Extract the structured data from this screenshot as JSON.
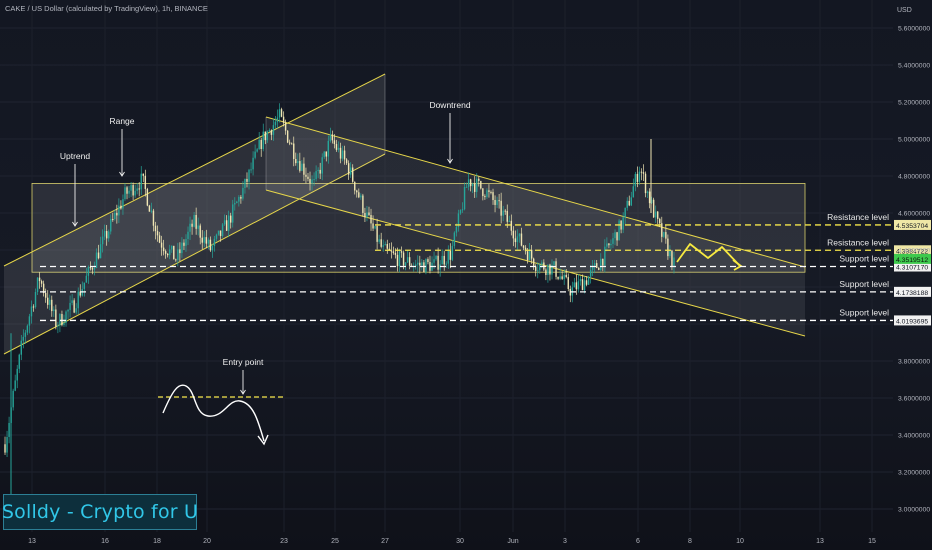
{
  "header": {
    "title": "CAKE / US Dollar (calculated by TradingView), 1h, BINANCE"
  },
  "brand": {
    "text": "Solldy - Crypto for U"
  },
  "colors": {
    "background": "#131722",
    "up": "#26a69a",
    "down": "#f0e6b4",
    "channel_line": "#e6d64a",
    "resistance": "#f5e64a",
    "support": "#ffffff",
    "annotation": "#ffffff",
    "last_price_bg": "#3ec94d",
    "projection": "#f7ea40"
  },
  "chart_data": {
    "type": "candlestick",
    "symbol": "CAKE / USD",
    "interval": "1h",
    "exchange": "BINANCE",
    "y_axis": {
      "unit": "USD",
      "ticks": [
        "5.6000000",
        "5.4000000",
        "5.2000000",
        "5.0000000",
        "4.8000000",
        "4.6000000",
        "4.4000000",
        "3.8000000",
        "3.6000000",
        "3.4000000",
        "3.2000000",
        "3.0000000"
      ],
      "range": [
        2.95,
        5.75
      ]
    },
    "x_axis": {
      "ticks": [
        "13",
        "16",
        "18",
        "20",
        "23",
        "25",
        "27",
        "30",
        "Jun",
        "3",
        "6",
        "8",
        "10",
        "13",
        "15"
      ]
    },
    "price_series": [
      {
        "t": "13",
        "price": 3.35
      },
      {
        "t": "13",
        "price": 3.9
      },
      {
        "t": "13",
        "price": 4.25
      },
      {
        "t": "14",
        "price": 4.0
      },
      {
        "t": "15",
        "price": 4.1
      },
      {
        "t": "15",
        "price": 4.3
      },
      {
        "t": "16",
        "price": 4.5
      },
      {
        "t": "17",
        "price": 4.7
      },
      {
        "t": "17",
        "price": 4.78
      },
      {
        "t": "18",
        "price": 4.45
      },
      {
        "t": "18",
        "price": 4.35
      },
      {
        "t": "19",
        "price": 4.55
      },
      {
        "t": "20",
        "price": 4.4
      },
      {
        "t": "21",
        "price": 4.55
      },
      {
        "t": "22",
        "price": 4.75
      },
      {
        "t": "23",
        "price": 5.0
      },
      {
        "t": "23",
        "price": 5.12
      },
      {
        "t": "24",
        "price": 4.9
      },
      {
        "t": "24",
        "price": 4.75
      },
      {
        "t": "25",
        "price": 5.0
      },
      {
        "t": "25",
        "price": 4.85
      },
      {
        "t": "26",
        "price": 4.6
      },
      {
        "t": "26",
        "price": 4.4
      },
      {
        "t": "27",
        "price": 4.35
      },
      {
        "t": "28",
        "price": 4.32
      },
      {
        "t": "29",
        "price": 4.32
      },
      {
        "t": "29",
        "price": 4.38
      },
      {
        "t": "30",
        "price": 4.78
      },
      {
        "t": "30",
        "price": 4.72
      },
      {
        "t": "31",
        "price": 4.6
      },
      {
        "t": "Jun",
        "price": 4.45
      },
      {
        "t": "Jun",
        "price": 4.32
      },
      {
        "t": "2",
        "price": 4.3
      },
      {
        "t": "3",
        "price": 4.18
      },
      {
        "t": "4",
        "price": 4.25
      },
      {
        "t": "5",
        "price": 4.38
      },
      {
        "t": "6",
        "price": 4.55
      },
      {
        "t": "6",
        "price": 4.85
      },
      {
        "t": "6",
        "price": 4.55
      },
      {
        "t": "7",
        "price": 4.32
      }
    ],
    "horizontal_levels": [
      {
        "label": "Resistance level",
        "price_label": "4.5353704",
        "value": 4.5353704,
        "style": "dashed",
        "kind": "resistance"
      },
      {
        "label": "Resistance level",
        "price_label": "4.3984722",
        "value": 4.3984722,
        "style": "dashed",
        "kind": "resistance"
      },
      {
        "label": "Support level",
        "price_label": "4.3107170",
        "value": 4.310717,
        "style": "dashed",
        "kind": "support"
      },
      {
        "label": "Support level",
        "price_label": "4.1738188",
        "value": 4.1738188,
        "style": "dashed",
        "kind": "support"
      },
      {
        "label": "Support level",
        "price_label": "4.0193695",
        "value": 4.0193695,
        "style": "dashed",
        "kind": "support"
      }
    ],
    "last_price": {
      "value": 4.3519512,
      "label": "4.3519512"
    },
    "annotations": [
      {
        "text": "Uptrend",
        "t": "14"
      },
      {
        "text": "Range",
        "t": "17"
      },
      {
        "text": "Downtrend",
        "t": "29"
      },
      {
        "text": "Entry point",
        "t": "20"
      }
    ],
    "drawings": [
      {
        "kind": "rectangle",
        "name": "range-zone",
        "from": "13",
        "to": "13",
        "price_top": 4.76,
        "price_bottom": 4.28
      },
      {
        "kind": "parallel-channel",
        "name": "uptrend-channel",
        "from": "13",
        "to": "27"
      },
      {
        "kind": "parallel-channel",
        "name": "downtrend-channel",
        "from": "23",
        "to": "13"
      },
      {
        "kind": "projection-path",
        "name": "price-projection",
        "from": "7",
        "to": "9"
      },
      {
        "kind": "example-path",
        "name": "entry-example"
      }
    ]
  }
}
